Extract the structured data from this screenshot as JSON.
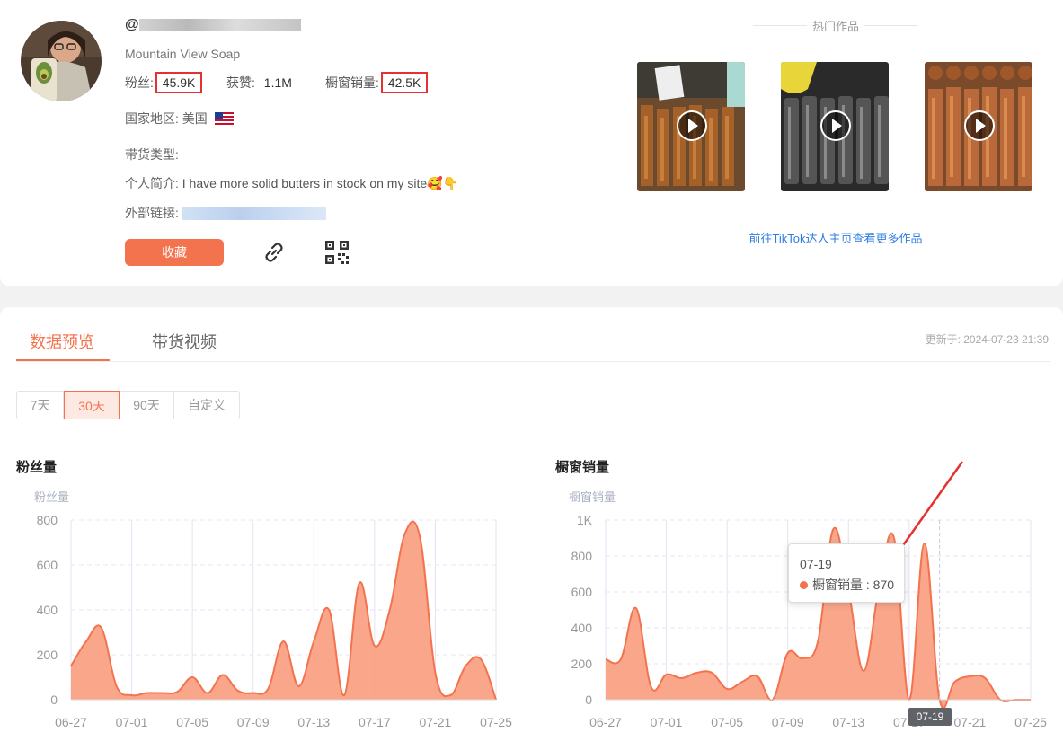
{
  "profile": {
    "username_prefix": "@",
    "shop_name": "Mountain View Soap",
    "followers_label": "粉丝:",
    "followers_value": "45.9K",
    "likes_label": "获赞:",
    "likes_value": "1.1M",
    "showcase_label": "橱窗销量:",
    "showcase_value": "42.5K",
    "region_label": "国家地区:",
    "region_value": "美国",
    "category_label": "带货类型:",
    "bio_label": "个人简介:",
    "bio_value": "I have more solid butters in stock on my site🥰👇",
    "link_label": "外部链接:",
    "fav_button": "收藏"
  },
  "hot": {
    "title": "热门作品",
    "more_link": "前往TikTok达人主页查看更多作品"
  },
  "tabs": [
    {
      "label": "数据预览",
      "active": true
    },
    {
      "label": "带货视频",
      "active": false
    }
  ],
  "updated": "更新于: 2024-07-23 21:39",
  "ranges": [
    {
      "label": "7天",
      "active": false
    },
    {
      "label": "30天",
      "active": true
    },
    {
      "label": "90天",
      "active": false
    },
    {
      "label": "自定义",
      "active": false
    }
  ],
  "chart_data": [
    {
      "type": "area",
      "title": "粉丝量",
      "ylabel": "粉丝量",
      "ylim": [
        0,
        800
      ],
      "yticks": [
        "0",
        "200",
        "400",
        "600",
        "800"
      ],
      "xticks": [
        "06-27",
        "07-01",
        "07-05",
        "07-09",
        "07-13",
        "07-17",
        "07-21",
        "07-25"
      ],
      "x": [
        "06-27",
        "06-28",
        "06-29",
        "06-30",
        "07-01",
        "07-02",
        "07-03",
        "07-04",
        "07-05",
        "07-06",
        "07-07",
        "07-08",
        "07-09",
        "07-10",
        "07-11",
        "07-12",
        "07-13",
        "07-14",
        "07-15",
        "07-16",
        "07-17",
        "07-18",
        "07-19",
        "07-20",
        "07-21",
        "07-22",
        "07-23",
        "07-24",
        "07-25"
      ],
      "values": [
        150,
        260,
        320,
        60,
        20,
        30,
        30,
        35,
        100,
        30,
        110,
        40,
        30,
        50,
        260,
        60,
        260,
        400,
        20,
        520,
        240,
        400,
        740,
        720,
        120,
        20,
        150,
        180,
        0
      ],
      "color": "#f4734f"
    },
    {
      "type": "area",
      "title": "橱窗销量",
      "ylabel": "橱窗销量",
      "ylim": [
        0,
        1000
      ],
      "yticks": [
        "0",
        "200",
        "400",
        "600",
        "800",
        "1K"
      ],
      "xticks": [
        "06-27",
        "07-01",
        "07-05",
        "07-09",
        "07-13",
        "07-17",
        "07-21",
        "07-25"
      ],
      "x": [
        "06-27",
        "06-28",
        "06-29",
        "06-30",
        "07-01",
        "07-02",
        "07-03",
        "07-04",
        "07-05",
        "07-06",
        "07-07",
        "07-08",
        "07-09",
        "07-10",
        "07-11",
        "07-12",
        "07-13",
        "07-14",
        "07-15",
        "07-16",
        "07-17",
        "07-18",
        "07-19",
        "07-20",
        "07-21",
        "07-22",
        "07-23",
        "07-24",
        "07-25"
      ],
      "values": [
        225,
        225,
        510,
        70,
        140,
        120,
        150,
        150,
        60,
        100,
        130,
        0,
        260,
        230,
        330,
        950,
        610,
        160,
        620,
        900,
        0,
        870,
        0,
        100,
        130,
        120,
        0,
        0,
        0
      ],
      "color": "#f4734f",
      "tooltip": {
        "date": "07-19",
        "label": "橱窗销量",
        "value": "870"
      }
    }
  ]
}
